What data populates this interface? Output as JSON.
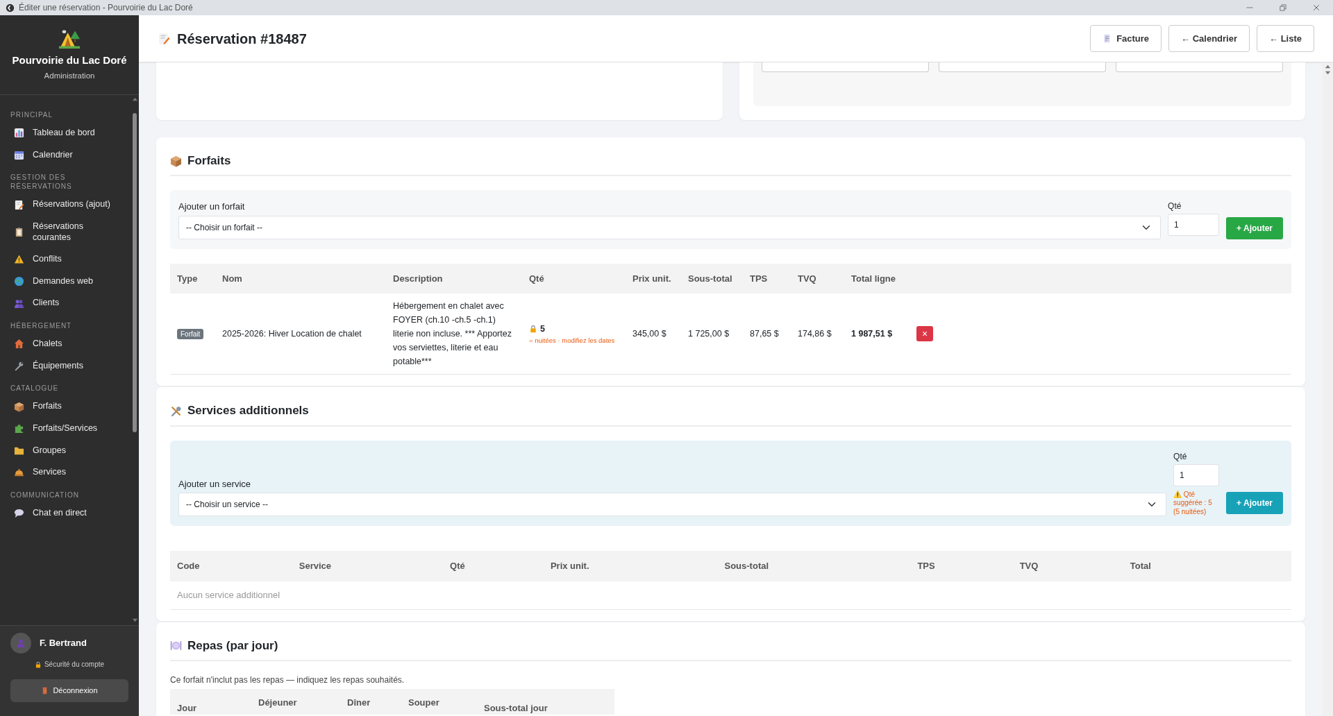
{
  "window": {
    "title": "Éditer une réservation - Pourvoirie du Lac Doré"
  },
  "sidebar": {
    "brand": "Pourvoirie du Lac Doré",
    "subtitle": "Administration",
    "sections": [
      {
        "label": "PRINCIPAL",
        "items": [
          {
            "label": "Tableau de bord"
          },
          {
            "label": "Calendrier"
          }
        ]
      },
      {
        "label": "GESTION DES RÉSERVATIONS",
        "items": [
          {
            "label": "Réservations (ajout)"
          },
          {
            "label": "Réservations courantes"
          },
          {
            "label": "Conflits"
          },
          {
            "label": "Demandes web"
          },
          {
            "label": "Clients"
          }
        ]
      },
      {
        "label": "HÉBERGEMENT",
        "items": [
          {
            "label": "Chalets"
          },
          {
            "label": "Équipements"
          }
        ]
      },
      {
        "label": "CATALOGUE",
        "items": [
          {
            "label": "Forfaits"
          },
          {
            "label": "Forfaits/Services"
          },
          {
            "label": "Groupes"
          },
          {
            "label": "Services"
          }
        ]
      },
      {
        "label": "COMMUNICATION",
        "items": [
          {
            "label": "Chat en direct"
          }
        ]
      }
    ],
    "user": {
      "name": "F. Bertrand",
      "security_link": "Sécurité du compte",
      "logout": "Déconnexion"
    }
  },
  "header": {
    "title": "Réservation #18487",
    "buttons": [
      {
        "label": "Facture",
        "kind": "doc"
      },
      {
        "label": "← Calendrier",
        "kind": "plain"
      },
      {
        "label": "← Liste",
        "kind": "plain"
      }
    ]
  },
  "forfaits": {
    "title": "Forfaits",
    "add_label": "Ajouter un forfait",
    "select_placeholder": "-- Choisir un forfait --",
    "qty_label": "Qté",
    "qty_value": "1",
    "add_button": "+ Ajouter",
    "columns": [
      "Type",
      "Nom",
      "Description",
      "Qté",
      "Prix unit.",
      "Sous-total",
      "TPS",
      "TVQ",
      "Total ligne"
    ],
    "rows": [
      {
        "type": "Forfait",
        "name": "2025-2026: Hiver Location de chalet",
        "description": "Hébergement en chalet avec FOYER (ch.10 -ch.5 -ch.1) literie non incluse. *** Apportez vos serviettes, literie et eau potable***",
        "qty": "5",
        "qty_note": "= nuitées · modifiez les dates",
        "unit_price": "345,00 $",
        "subtotal": "1 725,00 $",
        "tps": "87,65 $",
        "tvq": "174,86 $",
        "total": "1 987,51 $",
        "delete": "×"
      }
    ]
  },
  "services": {
    "title": "Services additionnels",
    "add_label": "Ajouter un service",
    "select_placeholder": "-- Choisir un service --",
    "qty_label": "Qté",
    "qty_value": "1",
    "qty_warning": "⚠️ Qté suggérée : 5 (5 nuitées)",
    "add_button": "+ Ajouter",
    "columns": [
      "Code",
      "Service",
      "Qté",
      "Prix unit.",
      "Sous-total",
      "TPS",
      "TVQ",
      "Total"
    ],
    "empty": "Aucun service additionnel"
  },
  "repas": {
    "title": "Repas (par jour)",
    "note": "Ce forfait n'inclut pas les repas — indiquez les repas souhaités.",
    "columns": [
      "Jour",
      "Déjeuner",
      "Dîner",
      "Souper",
      "Sous-total jour"
    ]
  }
}
